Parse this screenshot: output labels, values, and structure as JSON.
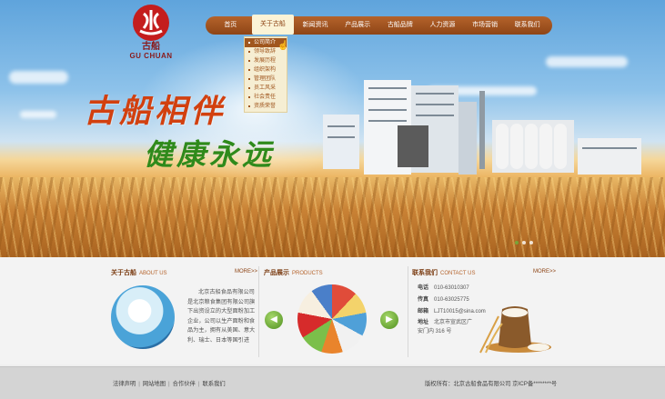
{
  "brand": {
    "name_cn": "古船",
    "name_en": "GU CHUAN"
  },
  "nav": {
    "items": [
      "首页",
      "关于古船",
      "新闻资讯",
      "产品展示",
      "古船品牌",
      "人力资源",
      "市场营销",
      "联系我们"
    ],
    "active_index": 1
  },
  "dropdown": {
    "items": [
      "公司简介",
      "领导致辞",
      "发展历程",
      "组织架构",
      "管理团队",
      "员工风采",
      "社会责任",
      "资质荣誉"
    ],
    "selected_index": 0
  },
  "hero": {
    "slogan_line1": "古船相伴",
    "slogan_line2": "健康永远"
  },
  "about": {
    "title": "关于古船",
    "title_en": "ABOUT US",
    "more": "MORE>>",
    "text": "北京古船食品有限公司是北京粮食集团有限公司旗下出资设立的大型面粉加工企业，公司以生产面粉和食品为主，拥有从美国、意大利、瑞士、日本等国引进"
  },
  "products": {
    "title": "产品展示",
    "title_en": "PRODUCTS",
    "more": "MORE>>"
  },
  "contact": {
    "title": "联系我们",
    "title_en": "CONTACT US",
    "more": "MORE>>",
    "rows": [
      {
        "label": "电话",
        "value": "010-63010307"
      },
      {
        "label": "传真",
        "value": "010-63025775"
      },
      {
        "label": "邮箱",
        "value": "LJT10015@sina.com"
      },
      {
        "label": "地址",
        "value": "北京市宣武区广安门内 316 号"
      }
    ]
  },
  "footer": {
    "links": [
      "法律声明",
      "网站地图",
      "合作伙伴",
      "联系我们"
    ],
    "copyright": "版权所有：北京古船食品有限公司  京ICP备********号"
  },
  "colors": {
    "brand_red": "#c41d1d",
    "nav_brown": "#8e4516",
    "accent_green": "#6cb33e"
  }
}
